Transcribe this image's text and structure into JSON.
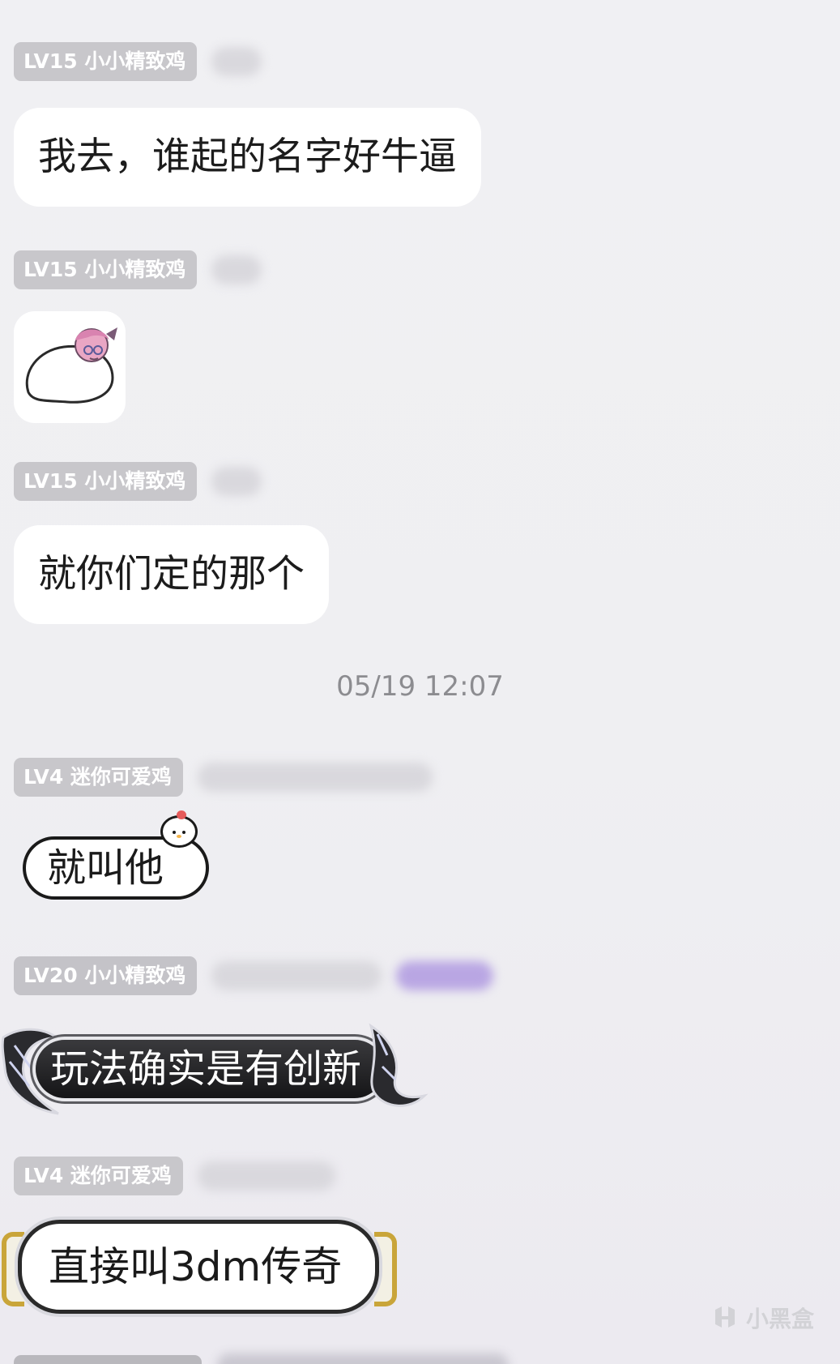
{
  "messages": [
    {
      "level_tag": "LV15 小小精致鸡",
      "text": "我去，谁起的名字好牛逼"
    },
    {
      "level_tag": "LV15 小小精致鸡",
      "sticker": "anime-egg-sticker"
    },
    {
      "level_tag": "LV15 小小精致鸡",
      "text": "就你们定的那个"
    },
    {
      "level_tag": "LV4 迷你可爱鸡",
      "text": "就叫他"
    },
    {
      "level_tag": "LV20 小小精致鸡",
      "text": "玩法确实是有创新"
    },
    {
      "level_tag": "LV4 迷你可爱鸡",
      "text": "直接叫3dm传奇"
    }
  ],
  "timestamp": "05/19 12:07",
  "watermark": {
    "text": "小黑盒",
    "icon": "heybox-logo-icon"
  },
  "colors": {
    "background": "#efeff2",
    "level_tag_bg": "#c8c7cb",
    "bubble_bg": "#ffffff",
    "timestamp_text": "#8c8c90",
    "bracket_gold": "#c9a53a"
  }
}
